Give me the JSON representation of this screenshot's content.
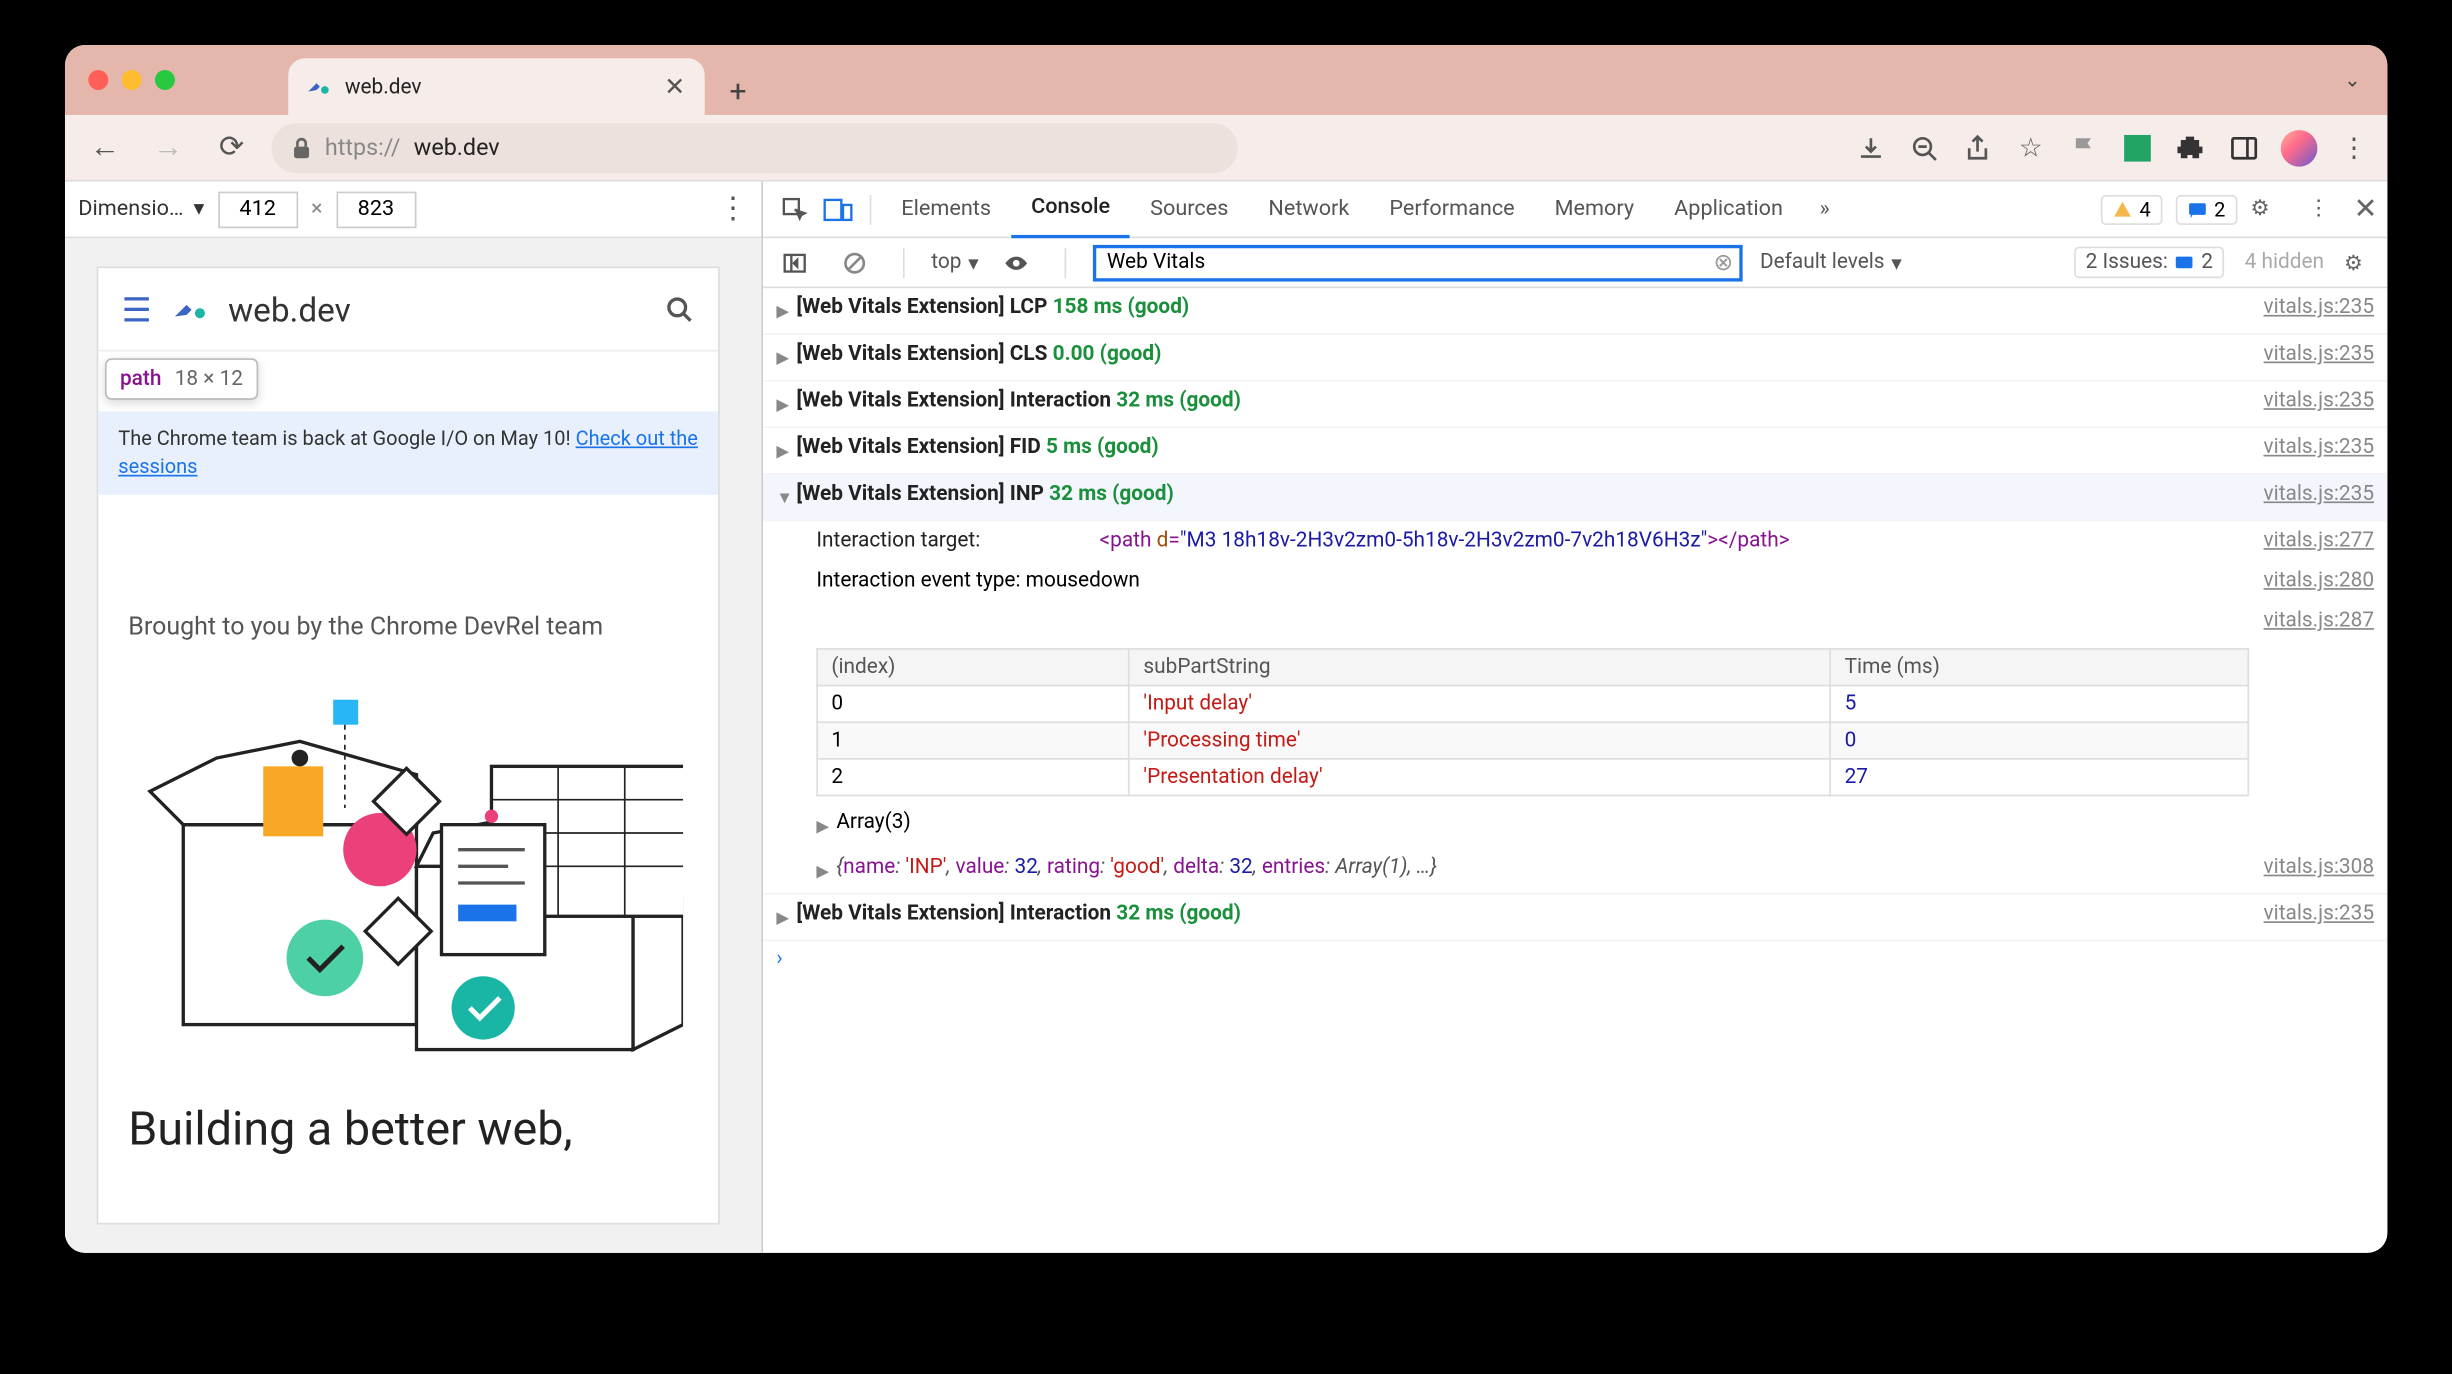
{
  "browser": {
    "tab_title": "web.dev",
    "url_prefix": "https://",
    "url_host": "web.dev",
    "dimensions_label": "Dimensio…",
    "width": "412",
    "height": "823",
    "sep": "×"
  },
  "page": {
    "brand": "web.dev",
    "tooltip_tag": "path",
    "tooltip_dims": "18 × 12",
    "banner_text": "The Chrome team is back at Google I/O on May 10! ",
    "banner_link": "Check out the sessions",
    "brought": "Brought to you by the Chrome DevRel team",
    "headline": "Building a better web,"
  },
  "devtools": {
    "tabs": [
      "Elements",
      "Console",
      "Sources",
      "Network",
      "Performance",
      "Memory",
      "Application"
    ],
    "active_tab": "Console",
    "warn_count": "4",
    "info_count": "2",
    "context": "top",
    "filter": "Web Vitals",
    "levels": "Default levels",
    "issues_label": "2 Issues:",
    "issues_count": "2",
    "hidden": "4 hidden"
  },
  "logs": [
    {
      "prefix": "[Web Vitals Extension]",
      "metric": "LCP",
      "value": "158 ms (good)",
      "src": "vitals.js:235"
    },
    {
      "prefix": "[Web Vitals Extension]",
      "metric": "CLS",
      "value": "0.00 (good)",
      "src": "vitals.js:235"
    },
    {
      "prefix": "[Web Vitals Extension]",
      "metric": "Interaction",
      "value": "32 ms (good)",
      "src": "vitals.js:235"
    },
    {
      "prefix": "[Web Vitals Extension]",
      "metric": "FID",
      "value": "5 ms (good)",
      "src": "vitals.js:235"
    },
    {
      "prefix": "[Web Vitals Extension]",
      "metric": "INP",
      "value": "32 ms (good)",
      "src": "vitals.js:235"
    }
  ],
  "inp_detail": {
    "target_label": "Interaction target:",
    "target_tag": "path",
    "target_attr_name": "d",
    "target_attr_val": "M3 18h18v-2H3v2zm0-5h18v-2H3v2zm0-7v2h18V6H3z",
    "target_src": "vitals.js:277",
    "event_label": "Interaction event type:",
    "event_type": "mousedown",
    "event_src": "vitals.js:280",
    "table_src": "vitals.js:287",
    "table": {
      "headers": [
        "(index)",
        "subPartString",
        "Time (ms)"
      ],
      "rows": [
        [
          "0",
          "'Input delay'",
          "5"
        ],
        [
          "1",
          "'Processing time'",
          "0"
        ],
        [
          "2",
          "'Presentation delay'",
          "27"
        ]
      ],
      "footer": "Array(3)"
    },
    "obj_preview": "{name: 'INP', value: 32, rating: 'good', delta: 32, entries: Array(1), …}",
    "obj_src": "vitals.js:308"
  },
  "trailing_log": {
    "prefix": "[Web Vitals Extension]",
    "metric": "Interaction",
    "value": "32 ms (good)",
    "src": "vitals.js:235"
  }
}
